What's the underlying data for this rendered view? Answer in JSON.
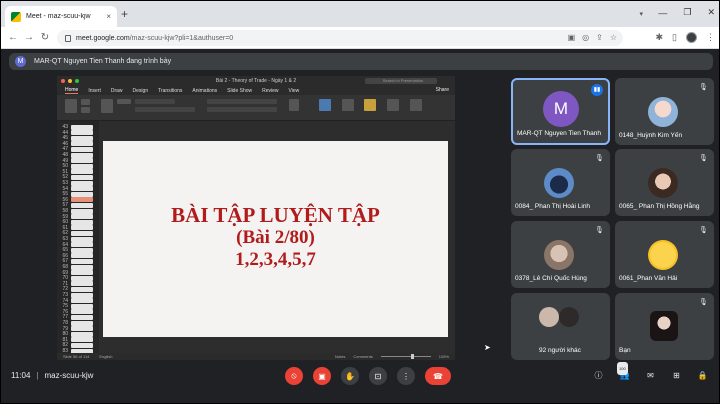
{
  "browser": {
    "tab_title": "Meet - maz-scuu-kjw",
    "url_domain": "meet.google.com",
    "url_rest": "/maz-scuu-kjw?pli=1&authuser=0",
    "new_tab": "+",
    "close": "×"
  },
  "banner": {
    "avatar_letter": "M",
    "text": "MAR-QT Nguyen Tien Thanh đang trình bày"
  },
  "ppt": {
    "doc_title": "Bài 2 - Theory of Trade - Ngày 1 & 2",
    "search_placeholder": "Search in Presentation",
    "tabs": [
      "Home",
      "Insert",
      "Draw",
      "Design",
      "Transitions",
      "Animations",
      "Slide Show",
      "Review",
      "View"
    ],
    "share_label": "Share",
    "slide_numbers": [
      "43",
      "44",
      "45",
      "46",
      "47",
      "48",
      "49",
      "50",
      "51",
      "52",
      "53",
      "54",
      "55",
      "56",
      "57",
      "58",
      "59",
      "60",
      "61",
      "62",
      "63",
      "64",
      "65",
      "66",
      "67",
      "68",
      "69",
      "70",
      "71",
      "72",
      "73",
      "74",
      "75",
      "76",
      "77",
      "78",
      "79",
      "80",
      "81",
      "82",
      "83"
    ],
    "slide_line1": "BÀI TẬP LUYỆN TẬP",
    "slide_line2": "(Bài 2/80)",
    "slide_line3": "1,2,3,4,5,7",
    "status_slide": "Slide 56 of 114",
    "status_lang": "English",
    "status_notes": "Notes",
    "status_comments": "Comments",
    "status_zoom": "105%"
  },
  "participants": [
    {
      "name": "MAR-QT Nguyen Tien Thanh",
      "avatar": "M",
      "speaking": true
    },
    {
      "name": "0148_Huỳnh Kim Yến"
    },
    {
      "name": "0084_ Phan Thị Hoài Linh"
    },
    {
      "name": "0065_ Phan Thị Hồng Hằng"
    },
    {
      "name": "0378_Lê Chí Quốc Hùng"
    },
    {
      "name": "0061_Phan Văn Hải"
    },
    {
      "name": "92 người khác"
    },
    {
      "name": "Bạn"
    }
  ],
  "bottom": {
    "time": "11:04",
    "separator": "|",
    "meeting_code": "maz-scuu-kjw",
    "participant_count": "100"
  },
  "colors": {
    "slide_text": "#b01c1c",
    "end_call": "#ea4335",
    "speaking_border": "#8ab4f8"
  }
}
